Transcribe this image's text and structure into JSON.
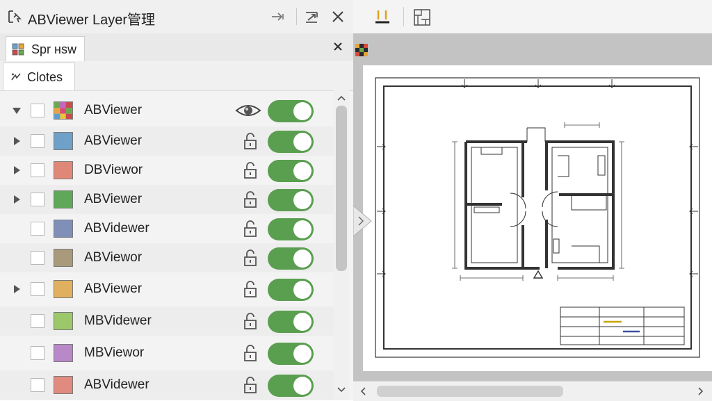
{
  "window": {
    "title": "ABViewer Layer管理",
    "icons": {
      "app": "layer-tool-icon",
      "pin": "pin-icon",
      "restore": "restore-icon",
      "close": "close-icon"
    }
  },
  "tab": {
    "label": "Spr нsw",
    "icon": "layers-grid-icon",
    "close_icon": "close-icon"
  },
  "subtab": {
    "label": "Clotes",
    "icon": "filter-icon"
  },
  "layers": [
    {
      "name": "ABViewer",
      "color": "multicolor",
      "state": "expanded",
      "status_icon": "eye-icon",
      "enabled": true
    },
    {
      "name": "ABViewer",
      "color": "#6fa0c8",
      "state": "collapsed",
      "status_icon": "lock-icon",
      "enabled": true
    },
    {
      "name": "DBViewor",
      "color": "#e08878",
      "state": "collapsed",
      "status_icon": "lock-icon",
      "enabled": true
    },
    {
      "name": "ABViewer",
      "color": "#5fa85a",
      "state": "collapsed",
      "status_icon": "lock-icon",
      "enabled": true
    },
    {
      "name": "ABVidewer",
      "color": "#7f8fb8",
      "state": "none",
      "status_icon": "lock-icon",
      "enabled": true
    },
    {
      "name": "ABViewor",
      "color": "#a89a7a",
      "state": "none",
      "status_icon": "lock-icon",
      "enabled": true
    },
    {
      "name": "ABViewer",
      "color": "#e0b060",
      "state": "collapsed",
      "status_icon": "lock-icon",
      "enabled": true
    },
    {
      "name": "MBVidewer",
      "color": "#9cc86a",
      "state": "none",
      "status_icon": "lock-icon",
      "enabled": true
    },
    {
      "name": "MBViewor",
      "color": "#b888c8",
      "state": "none",
      "status_icon": "lock-icon",
      "enabled": true
    },
    {
      "name": "ABVidewer",
      "color": "#e08a80",
      "state": "none",
      "status_icon": "lock-icon",
      "enabled": true
    }
  ],
  "toolbar": {
    "icons": [
      "layer-color-icon",
      "layout-icon"
    ]
  },
  "viewport": {
    "icon": "color-grid-icon",
    "content": "floor-plan-drawing"
  },
  "colors": {
    "toggle_on": "#5a9e4f",
    "panel_bg": "#f3f3f3",
    "viewport_bg": "#c3c3c3"
  }
}
